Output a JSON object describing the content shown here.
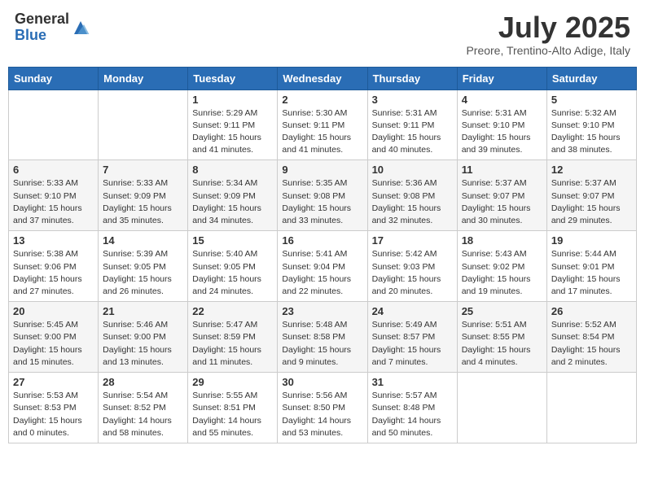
{
  "header": {
    "logo_general": "General",
    "logo_blue": "Blue",
    "month_title": "July 2025",
    "subtitle": "Preore, Trentino-Alto Adige, Italy"
  },
  "days_of_week": [
    "Sunday",
    "Monday",
    "Tuesday",
    "Wednesday",
    "Thursday",
    "Friday",
    "Saturday"
  ],
  "weeks": [
    [
      {
        "day": "",
        "info": ""
      },
      {
        "day": "",
        "info": ""
      },
      {
        "day": "1",
        "info": "Sunrise: 5:29 AM\nSunset: 9:11 PM\nDaylight: 15 hours and 41 minutes."
      },
      {
        "day": "2",
        "info": "Sunrise: 5:30 AM\nSunset: 9:11 PM\nDaylight: 15 hours and 41 minutes."
      },
      {
        "day": "3",
        "info": "Sunrise: 5:31 AM\nSunset: 9:11 PM\nDaylight: 15 hours and 40 minutes."
      },
      {
        "day": "4",
        "info": "Sunrise: 5:31 AM\nSunset: 9:10 PM\nDaylight: 15 hours and 39 minutes."
      },
      {
        "day": "5",
        "info": "Sunrise: 5:32 AM\nSunset: 9:10 PM\nDaylight: 15 hours and 38 minutes."
      }
    ],
    [
      {
        "day": "6",
        "info": "Sunrise: 5:33 AM\nSunset: 9:10 PM\nDaylight: 15 hours and 37 minutes."
      },
      {
        "day": "7",
        "info": "Sunrise: 5:33 AM\nSunset: 9:09 PM\nDaylight: 15 hours and 35 minutes."
      },
      {
        "day": "8",
        "info": "Sunrise: 5:34 AM\nSunset: 9:09 PM\nDaylight: 15 hours and 34 minutes."
      },
      {
        "day": "9",
        "info": "Sunrise: 5:35 AM\nSunset: 9:08 PM\nDaylight: 15 hours and 33 minutes."
      },
      {
        "day": "10",
        "info": "Sunrise: 5:36 AM\nSunset: 9:08 PM\nDaylight: 15 hours and 32 minutes."
      },
      {
        "day": "11",
        "info": "Sunrise: 5:37 AM\nSunset: 9:07 PM\nDaylight: 15 hours and 30 minutes."
      },
      {
        "day": "12",
        "info": "Sunrise: 5:37 AM\nSunset: 9:07 PM\nDaylight: 15 hours and 29 minutes."
      }
    ],
    [
      {
        "day": "13",
        "info": "Sunrise: 5:38 AM\nSunset: 9:06 PM\nDaylight: 15 hours and 27 minutes."
      },
      {
        "day": "14",
        "info": "Sunrise: 5:39 AM\nSunset: 9:05 PM\nDaylight: 15 hours and 26 minutes."
      },
      {
        "day": "15",
        "info": "Sunrise: 5:40 AM\nSunset: 9:05 PM\nDaylight: 15 hours and 24 minutes."
      },
      {
        "day": "16",
        "info": "Sunrise: 5:41 AM\nSunset: 9:04 PM\nDaylight: 15 hours and 22 minutes."
      },
      {
        "day": "17",
        "info": "Sunrise: 5:42 AM\nSunset: 9:03 PM\nDaylight: 15 hours and 20 minutes."
      },
      {
        "day": "18",
        "info": "Sunrise: 5:43 AM\nSunset: 9:02 PM\nDaylight: 15 hours and 19 minutes."
      },
      {
        "day": "19",
        "info": "Sunrise: 5:44 AM\nSunset: 9:01 PM\nDaylight: 15 hours and 17 minutes."
      }
    ],
    [
      {
        "day": "20",
        "info": "Sunrise: 5:45 AM\nSunset: 9:00 PM\nDaylight: 15 hours and 15 minutes."
      },
      {
        "day": "21",
        "info": "Sunrise: 5:46 AM\nSunset: 9:00 PM\nDaylight: 15 hours and 13 minutes."
      },
      {
        "day": "22",
        "info": "Sunrise: 5:47 AM\nSunset: 8:59 PM\nDaylight: 15 hours and 11 minutes."
      },
      {
        "day": "23",
        "info": "Sunrise: 5:48 AM\nSunset: 8:58 PM\nDaylight: 15 hours and 9 minutes."
      },
      {
        "day": "24",
        "info": "Sunrise: 5:49 AM\nSunset: 8:57 PM\nDaylight: 15 hours and 7 minutes."
      },
      {
        "day": "25",
        "info": "Sunrise: 5:51 AM\nSunset: 8:55 PM\nDaylight: 15 hours and 4 minutes."
      },
      {
        "day": "26",
        "info": "Sunrise: 5:52 AM\nSunset: 8:54 PM\nDaylight: 15 hours and 2 minutes."
      }
    ],
    [
      {
        "day": "27",
        "info": "Sunrise: 5:53 AM\nSunset: 8:53 PM\nDaylight: 15 hours and 0 minutes."
      },
      {
        "day": "28",
        "info": "Sunrise: 5:54 AM\nSunset: 8:52 PM\nDaylight: 14 hours and 58 minutes."
      },
      {
        "day": "29",
        "info": "Sunrise: 5:55 AM\nSunset: 8:51 PM\nDaylight: 14 hours and 55 minutes."
      },
      {
        "day": "30",
        "info": "Sunrise: 5:56 AM\nSunset: 8:50 PM\nDaylight: 14 hours and 53 minutes."
      },
      {
        "day": "31",
        "info": "Sunrise: 5:57 AM\nSunset: 8:48 PM\nDaylight: 14 hours and 50 minutes."
      },
      {
        "day": "",
        "info": ""
      },
      {
        "day": "",
        "info": ""
      }
    ]
  ]
}
